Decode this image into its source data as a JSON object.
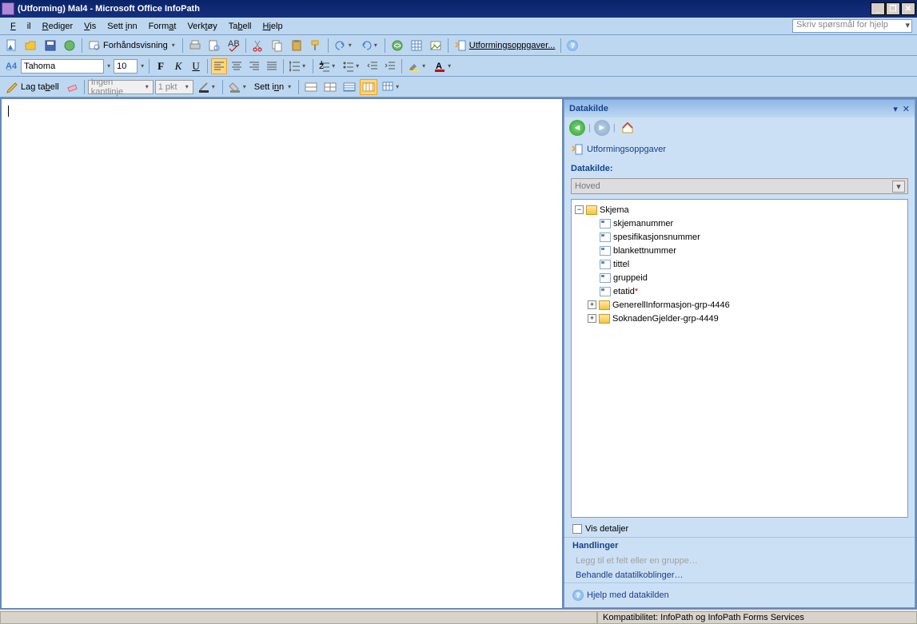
{
  "title": "(Utforming) Mal4 - Microsoft Office InfoPath",
  "menu": {
    "fil": "Fil",
    "rediger": "Rediger",
    "vis": "Vis",
    "settinn": "Sett inn",
    "format": "Format",
    "verktoy": "Verktøy",
    "tabell": "Tabell",
    "hjelp": "Hjelp"
  },
  "help_placeholder": "Skriv spørsmål for hjelp",
  "toolbar1": {
    "preview": "Forhåndsvisning",
    "design_tasks": "Utformingsoppgaver..."
  },
  "format_toolbar": {
    "font": "Tahoma",
    "size": "10"
  },
  "table_toolbar": {
    "make_table": "Lag tabell",
    "no_border": "Ingen kantlinje",
    "pt": "1 pkt",
    "insert": "Sett inn"
  },
  "taskpane": {
    "title": "Datakilde",
    "design_tasks_link": "Utformingsoppgaver",
    "section_label": "Datakilde:",
    "source_select": "Hoved",
    "tree": {
      "root": "Skjema",
      "fields": [
        "skjemanummer",
        "spesifikasjonsnummer",
        "blankettnummer",
        "tittel",
        "gruppeid"
      ],
      "req_field": "etatid",
      "groups": [
        "GenerellInformasjon-grp-4446",
        "SoknadenGjelder-grp-4449"
      ]
    },
    "show_details": "Vis detaljer",
    "actions_head": "Handlinger",
    "add_field": "Legg til et felt eller en gruppe…",
    "manage_conn": "Behandle datatilkoblinger…",
    "help": "Hjelp med datakilden"
  },
  "status": {
    "compat": "Kompatibilitet: InfoPath og InfoPath Forms Services"
  }
}
